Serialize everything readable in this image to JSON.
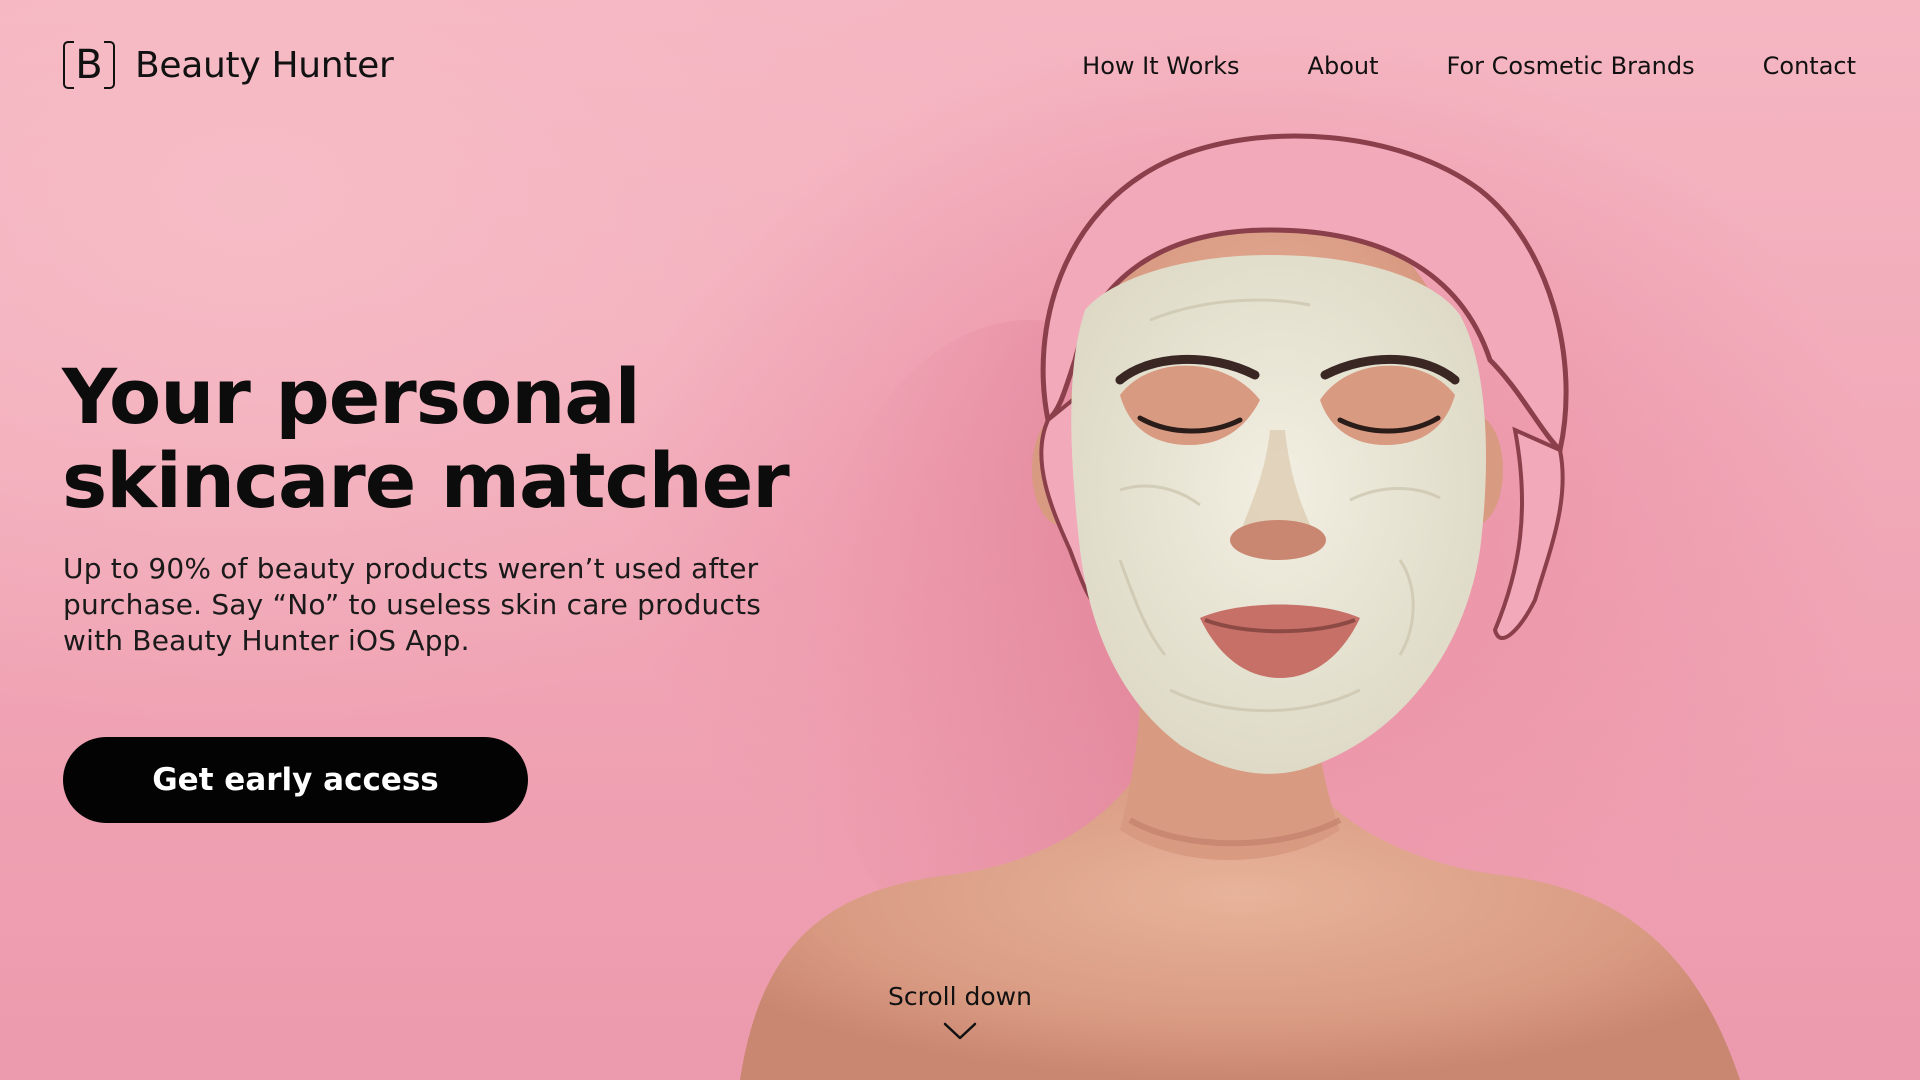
{
  "header": {
    "logo_letter": "B",
    "brand_name": "Beauty Hunter",
    "nav": [
      {
        "label": "How It Works"
      },
      {
        "label": "About"
      },
      {
        "label": "For Cosmetic Brands"
      },
      {
        "label": "Contact"
      }
    ]
  },
  "hero": {
    "headline_line1": "Your personal",
    "headline_line2": "skincare matcher",
    "subtext": "Up to 90% of beauty products weren’t used after purchase. Say “No” to useless skin care products with Beauty Hunter iOS App.",
    "cta_label": "Get early access",
    "image_subject": "woman-with-face-mask-and-shower-cap"
  },
  "scroll": {
    "label": "Scroll down",
    "icon": "chevron-down-icon"
  },
  "colors": {
    "background": "#f2a7b6",
    "text": "#0d0d0d",
    "cta_background": "#030303",
    "cta_text": "#ffffff",
    "mask": "#ece8d8",
    "cap": "#f0a8b8"
  }
}
